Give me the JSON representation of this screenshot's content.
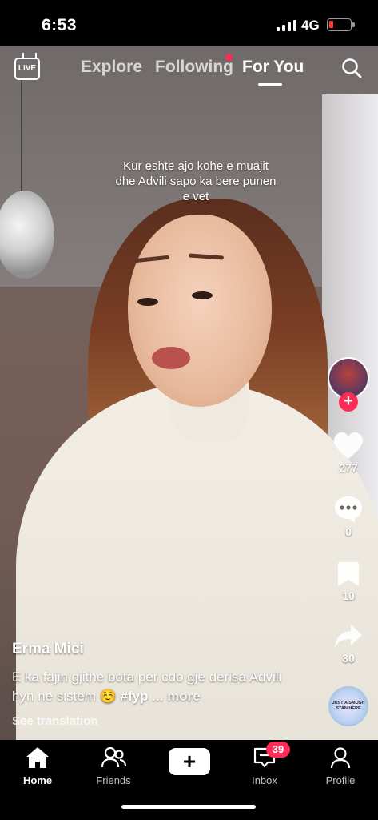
{
  "status_bar": {
    "time": "6:53",
    "network": "4G"
  },
  "top_nav": {
    "live_label": "LIVE",
    "tabs": [
      {
        "label": "Explore",
        "active": false
      },
      {
        "label": "Following",
        "active": false,
        "has_dot": true
      },
      {
        "label": "For You",
        "active": true
      }
    ]
  },
  "video": {
    "overlay_caption": "Kur eshte ajo kohe e muajit dhe Advili sapo ka bere punen e vet"
  },
  "rail": {
    "likes": "277",
    "comments": "0",
    "saves": "10",
    "shares": "30",
    "music_disc_text": "JUST A SMOSH STAN HERE"
  },
  "post": {
    "author": "Erma Mici",
    "description": "E ka fajin gjithe bota per cdo gje derisa Advili hyn ne sistem",
    "emoji": "☺️",
    "hashtag": "#fyp",
    "more": "... more",
    "see_translation": "See translation"
  },
  "bottom_nav": {
    "items": [
      {
        "label": "Home",
        "active": true
      },
      {
        "label": "Friends",
        "active": false
      },
      {
        "label": "Inbox",
        "active": false,
        "badge": "39"
      },
      {
        "label": "Profile",
        "active": false
      }
    ]
  },
  "colors": {
    "accent": "#fe2c55",
    "cyan": "#25f4ee",
    "background": "#000000"
  }
}
